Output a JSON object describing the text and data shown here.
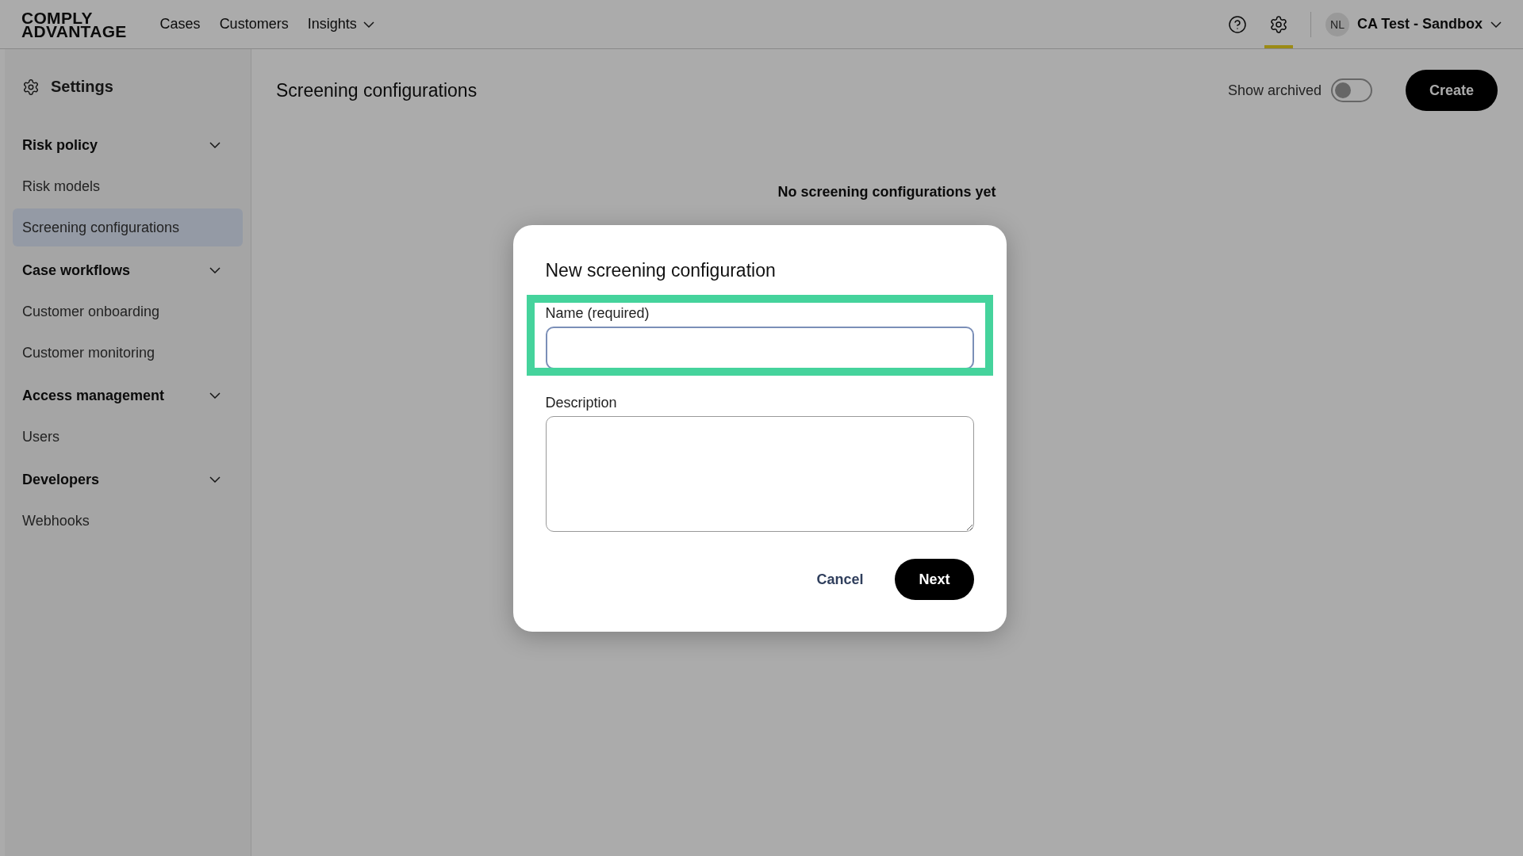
{
  "header": {
    "logo_lines": [
      "COMPLY",
      "ADVANTAGE"
    ],
    "nav": [
      {
        "label": "Cases",
        "dropdown": false
      },
      {
        "label": "Customers",
        "dropdown": false
      },
      {
        "label": "Insights",
        "dropdown": true
      }
    ],
    "settings_active": true,
    "account": {
      "initials": "NL",
      "name": "CA Test - Sandbox"
    }
  },
  "sidebar": {
    "title": "Settings",
    "sections": [
      {
        "title": "Risk policy",
        "expanded": true,
        "items": [
          {
            "label": "Risk models",
            "selected": false
          },
          {
            "label": "Screening configurations",
            "selected": true
          }
        ]
      },
      {
        "title": "Case workflows",
        "expanded": true,
        "items": [
          {
            "label": "Customer onboarding",
            "selected": false
          },
          {
            "label": "Customer monitoring",
            "selected": false
          }
        ]
      },
      {
        "title": "Access management",
        "expanded": true,
        "items": [
          {
            "label": "Users",
            "selected": false
          }
        ]
      },
      {
        "title": "Developers",
        "expanded": true,
        "items": [
          {
            "label": "Webhooks",
            "selected": false
          }
        ]
      }
    ]
  },
  "main": {
    "title": "Screening configurations",
    "show_archived": {
      "label": "Show archived",
      "on": false
    },
    "create_button": "Create",
    "empty_title": "No screening configurations yet"
  },
  "dialog": {
    "title": "New screening configuration",
    "name_label": "Name (required)",
    "description_label": "Description",
    "cancel": "Cancel",
    "next": "Next"
  }
}
